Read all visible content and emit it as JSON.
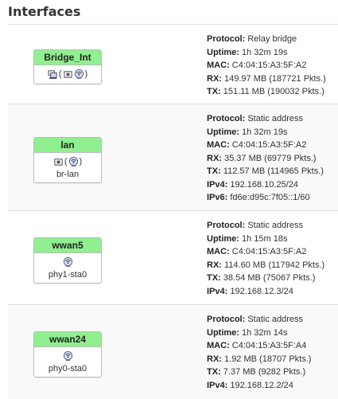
{
  "title": "Interfaces",
  "colors": {
    "badge_green": "#90f090",
    "row_alt": "#f9f9f9",
    "divider": "#dddddd"
  },
  "interfaces": [
    {
      "name": "Bridge_Int",
      "icons": [
        "bridge-icon",
        "wired-port-icon",
        "wireless-icon"
      ],
      "device": "",
      "labels": {
        "protocol": "Protocol:",
        "uptime": "Uptime:",
        "mac": "MAC:",
        "rx": "RX:",
        "tx": "TX:"
      },
      "protocol": "Relay bridge",
      "uptime": "1h 32m 19s",
      "mac": "C4:04:15:A3:5F:A2",
      "rx": "149.97 MB (187721 Pkts.)",
      "tx": "151.11 MB (190032 Pkts.)"
    },
    {
      "name": "lan",
      "icons": [
        "wired-port-icon",
        "wireless-icon"
      ],
      "device": "br-lan",
      "labels": {
        "protocol": "Protocol:",
        "uptime": "Uptime:",
        "mac": "MAC:",
        "rx": "RX:",
        "tx": "TX:",
        "ipv4": "IPv4:",
        "ipv6": "IPv6:"
      },
      "protocol": "Static address",
      "uptime": "1h 32m 19s",
      "mac": "C4:04:15:A3:5F:A2",
      "rx": "35.37 MB (69779 Pkts.)",
      "tx": "112.57 MB (114965 Pkts.)",
      "ipv4": "192.168.10.25/24",
      "ipv6": "fd6e:d95c:7f05::1/60"
    },
    {
      "name": "wwan5",
      "icons": [
        "wireless-icon"
      ],
      "device": "phy1-sta0",
      "labels": {
        "protocol": "Protocol:",
        "uptime": "Uptime:",
        "mac": "MAC:",
        "rx": "RX:",
        "tx": "TX:",
        "ipv4": "IPv4:"
      },
      "protocol": "Static address",
      "uptime": "1h 15m 18s",
      "mac": "C4:04:15:A3:5F:A2",
      "rx": "114.60 MB (117942 Pkts.)",
      "tx": "38.54 MB (75067 Pkts.)",
      "ipv4": "192.168.12.3/24"
    },
    {
      "name": "wwan24",
      "icons": [
        "wireless-icon"
      ],
      "device": "phy0-sta0",
      "labels": {
        "protocol": "Protocol:",
        "uptime": "Uptime:",
        "mac": "MAC:",
        "rx": "RX:",
        "tx": "TX:",
        "ipv4": "IPv4:"
      },
      "protocol": "Static address",
      "uptime": "1h 32m 14s",
      "mac": "C4:04:15:A3:5F:A4",
      "rx": "1.92 MB (18707 Pkts.)",
      "tx": "7.37 MB (9282 Pkts.)",
      "ipv4": "192.168.12.2/24"
    }
  ]
}
